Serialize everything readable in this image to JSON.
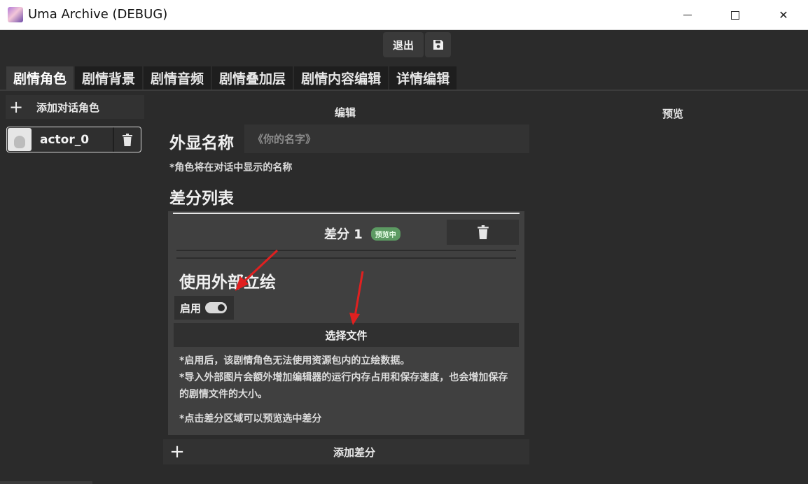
{
  "window": {
    "title": "Uma Archive (DEBUG)",
    "minimize_label": "",
    "close_label": "✕"
  },
  "toolbar": {
    "exit_label": "退出",
    "save_icon": "save-icon"
  },
  "tabs": [
    {
      "label": "剧情角色",
      "active": true
    },
    {
      "label": "剧情背景",
      "active": false
    },
    {
      "label": "剧情音频",
      "active": false
    },
    {
      "label": "剧情叠加层",
      "active": false
    },
    {
      "label": "剧情内容编辑",
      "active": false
    },
    {
      "label": "详情编辑",
      "active": false
    }
  ],
  "sidebar": {
    "add_role_label": "添加对话角色",
    "actors": [
      {
        "name": "actor_0"
      }
    ]
  },
  "editor": {
    "header": "编辑",
    "display_name_label": "外显名称",
    "display_name_placeholder": "《你的名字》",
    "display_name_value": "",
    "display_name_hint": "*角色将在对话中显示的名称",
    "diff_list_title": "差分列表",
    "diff": {
      "name": "差分 1",
      "badge": "预览中",
      "external_title": "使用外部立绘",
      "enable_label": "启用",
      "enable_on": true,
      "choose_file_label": "选择文件",
      "note1": "*启用后，该剧情角色无法使用资源包内的立绘数据。",
      "note2": "*导入外部图片会额外增加编辑器的运行内存占用和保存速度，也会增加保存的剧情文件的大小。",
      "note3": "*点击差分区域可以预览选中差分"
    },
    "add_diff_label": "添加差分"
  },
  "preview": {
    "header": "预览"
  },
  "colors": {
    "background": "#2b2b2b",
    "panel": "#404040",
    "badge": "#5c9a62",
    "annotation_arrow": "#e02020"
  }
}
